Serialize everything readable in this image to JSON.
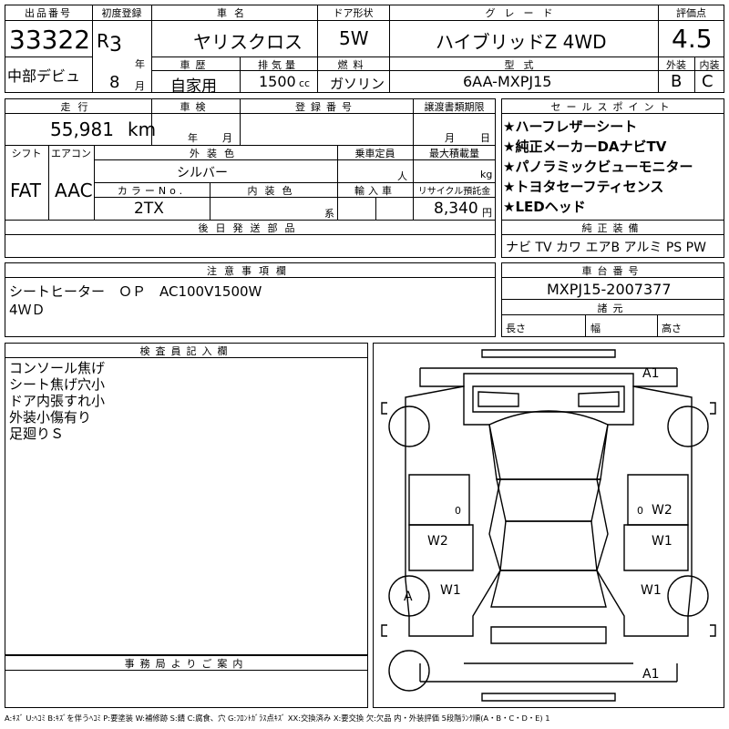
{
  "header": {
    "lot_no_label": "出品番号",
    "lot_no": "33322",
    "first_reg_label": "初度登録",
    "era": "R",
    "year": "3",
    "year_unit": "年",
    "month": "8",
    "month_unit": "月",
    "debut": "中部デビュ",
    "car_name_label": "車名",
    "car_name": "ヤリスクロス",
    "door_label": "ドア形状",
    "door": "5W",
    "grade_label": "グレード",
    "grade": "ハイブリッドZ 4WD",
    "score_label": "評価点",
    "score": "4.5",
    "history_label": "車歴",
    "history": "自家用",
    "displacement_label": "排気量",
    "displacement": "1500",
    "displacement_unit": "cc",
    "fuel_label": "燃料",
    "fuel": "ガソリン",
    "model_label": "型式",
    "model": "6AA-MXPJ15",
    "exterior_label": "外装",
    "exterior_grade": "B",
    "interior_label": "内装",
    "interior_grade": "C"
  },
  "row2": {
    "mileage_label": "走行",
    "mileage": "55,981",
    "mileage_unit": "km",
    "inspection_label": "車検",
    "inspection_year_unit": "年",
    "inspection_month_unit": "月",
    "reg_no_label": "登録番号",
    "transfer_label": "譲渡書類期限",
    "transfer_month_unit": "月",
    "transfer_day_unit": "日",
    "shift_label": "シフト",
    "shift": "FAT",
    "ac_label": "エアコン",
    "ac": "AAC",
    "ext_color_label": "外装色",
    "ext_color": "シルバー",
    "capacity_label": "乗車定員",
    "capacity_unit": "人",
    "load_label": "最大積載量",
    "load_unit": "kg",
    "color_no_label": "カラーNo.",
    "color_no": "2TX",
    "int_color_label": "内装色",
    "int_color_unit": "系",
    "import_label": "輸入車",
    "recycle_label": "リサイクル預託金",
    "recycle": "8,340",
    "recycle_unit": "円",
    "later_label": "後日発送部品"
  },
  "sales": {
    "label": "セールスポイント",
    "items": [
      "★ハーフレザーシート",
      "★純正メーカーDAナビTV",
      "★パノラミックビューモニター",
      "★トヨタセーフティセンス",
      "★LEDヘッド"
    ]
  },
  "equipment": {
    "label": "純正装備",
    "value": "ナビ TV カワ エアB アルミ PS PW"
  },
  "notes": {
    "label": "注意事項欄",
    "lines": [
      "シートヒーター　ＯＰ　AC100V1500W",
      "4ＷＤ"
    ]
  },
  "chassis": {
    "label": "車台番号",
    "value": "MXPJ15-2007377",
    "spec_label": "諸元",
    "length_label": "長さ",
    "width_label": "幅",
    "height_label": "高さ"
  },
  "inspector": {
    "label": "検査員記入欄",
    "lines": [
      "コンソール焦げ",
      "シート焦げ穴小",
      "ドア内張すれ小",
      "外装小傷有り",
      "足廻りＳ"
    ]
  },
  "office": {
    "label": "事務局よりご案内"
  },
  "diagram": {
    "marks": {
      "front_top": "A1",
      "rear_bottom": "A1",
      "right_rear_door": "W2",
      "left_front_door": "W2",
      "right_front_door": "W1",
      "left_front_fender": "W1",
      "right_front_fender": "W1",
      "front_left_wheel": "A",
      "left_rear_small": "0",
      "right_rear_small": "0"
    }
  },
  "legend": "A:ｷｽﾞ U:ﾍｺﾐ B:ｷｽﾞを伴うﾍｺﾐ P:要塗装 W:補修跡 S:錆 C:腐食、穴 G:ﾌﾛﾝﾄｶﾞﾗｽ点ｷｽﾞ XX:交換済み X:要交換 欠:欠品 内・外装評価 5段階ﾗﾝｸ順(A・B・C・D・E) 1"
}
